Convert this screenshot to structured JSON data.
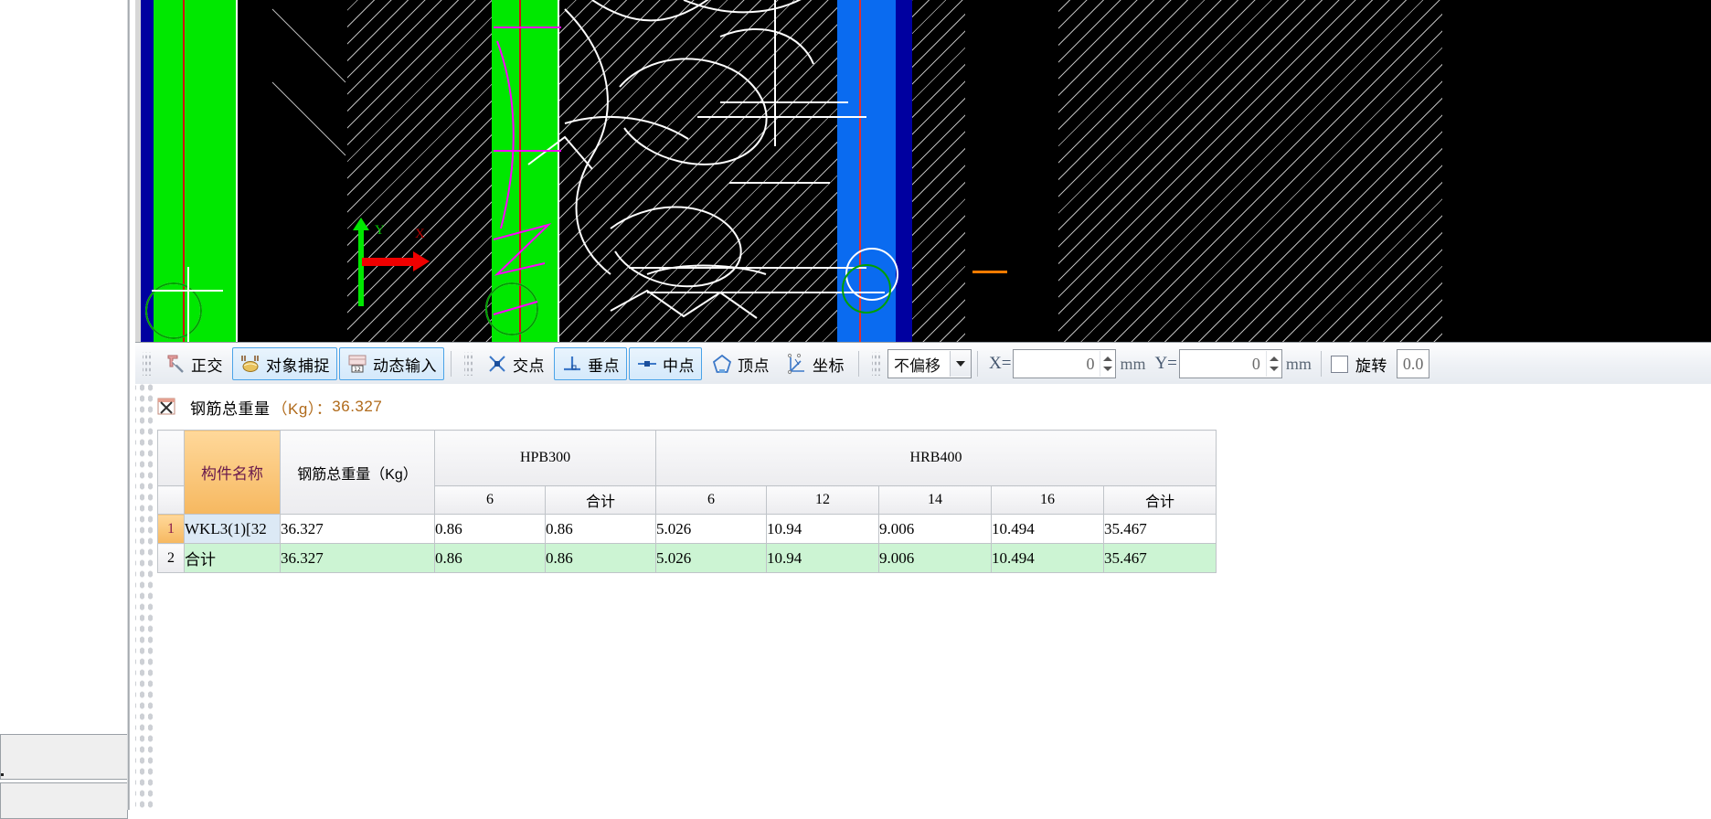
{
  "canvas": {
    "axis_x_label": "X",
    "axis_y_label": "Y",
    "background": "#000000",
    "colors": {
      "green_member": "#00e800",
      "navy": "#0000a0",
      "blue": "#0a6bf0",
      "red_axis": "#d21010",
      "rebar": "#ffffff",
      "magenta": "#ff00ff"
    }
  },
  "toolbar": {
    "ortho_label": "正交",
    "osnap_label": "对象捕捉",
    "dyninput_label": "动态输入",
    "intersection_label": "交点",
    "perpendicular_label": "垂点",
    "midpoint_label": "中点",
    "vertex_label": "顶点",
    "coordinate_label": "坐标",
    "offset_mode": "不偏移",
    "x_label": "X=",
    "x_value": "0",
    "x_unit": "mm",
    "y_label": "Y=",
    "y_value": "0",
    "y_unit": "mm",
    "rotate_label": "旋转",
    "rotate_value": "0.0"
  },
  "results": {
    "title_main": "钢筋总重量",
    "title_unit": "（Kg）：",
    "title_value": "36.327",
    "close_icon": "close-x-icon",
    "table": {
      "col_name": "构件名称",
      "col_total_weight": "钢筋总重量（Kg）",
      "groups": [
        {
          "name": "HPB300",
          "subs": [
            "6",
            "合计"
          ]
        },
        {
          "name": "HRB400",
          "subs": [
            "6",
            "12",
            "14",
            "16",
            "合计"
          ]
        }
      ],
      "rows": [
        {
          "no": "1",
          "name": "WKL3(1)[32",
          "total": "36.327",
          "values": [
            "0.86",
            "0.86",
            "5.026",
            "10.94",
            "9.006",
            "10.494",
            "35.467"
          ],
          "selected": true,
          "is_total_row": false
        },
        {
          "no": "2",
          "name": "合计",
          "total": "36.327",
          "values": [
            "0.86",
            "0.86",
            "5.026",
            "10.94",
            "9.006",
            "10.494",
            "35.467"
          ],
          "selected": false,
          "is_total_row": true
        }
      ]
    }
  }
}
